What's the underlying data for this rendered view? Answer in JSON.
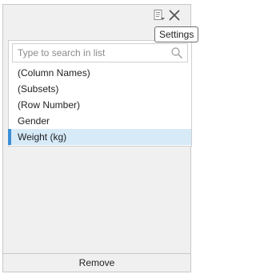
{
  "toolbar": {
    "settings_icon": "settings-list-icon",
    "close_icon": "close-icon",
    "tooltip": "Settings"
  },
  "search": {
    "placeholder": "Type to search in list",
    "value": "",
    "icon": "search-icon"
  },
  "list": {
    "items": [
      {
        "label": "(Column Names)",
        "selected": false
      },
      {
        "label": "(Subsets)",
        "selected": false
      },
      {
        "label": "(Row Number)",
        "selected": false
      },
      {
        "label": "Gender",
        "selected": false
      },
      {
        "label": "Weight (kg)",
        "selected": true
      }
    ]
  },
  "footer": {
    "remove_label": "Remove"
  },
  "colors": {
    "panel_bg": "#f0f0f0",
    "selected_bg": "#d6eaf8",
    "selected_marker": "#3b8ed4"
  }
}
